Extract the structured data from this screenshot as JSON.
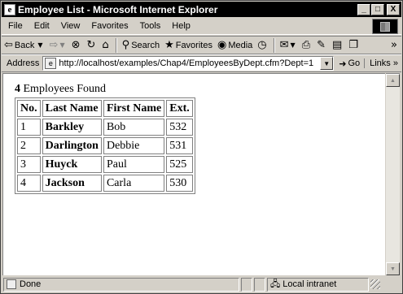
{
  "window": {
    "title": "Employee List - Microsoft Internet Explorer",
    "controls": {
      "minimize": "_",
      "maximize": "□",
      "close": "X"
    }
  },
  "menu": [
    "File",
    "Edit",
    "View",
    "Favorites",
    "Tools",
    "Help"
  ],
  "toolbar": {
    "back": "Back",
    "search": "Search",
    "favorites": "Favorites",
    "media": "Media"
  },
  "address": {
    "label": "Address",
    "value": "http://localhost/examples/Chap4/EmployeesByDept.cfm?Dept=1",
    "go": "Go",
    "links": "Links"
  },
  "page": {
    "count": "4",
    "found_text": " Employees Found",
    "table": {
      "headers": [
        "No.",
        "Last Name",
        "First Name",
        "Ext."
      ],
      "rows": [
        [
          "1",
          "Barkley",
          "Bob",
          "532"
        ],
        [
          "2",
          "Darlington",
          "Debbie",
          "531"
        ],
        [
          "3",
          "Huyck",
          "Paul",
          "525"
        ],
        [
          "4",
          "Jackson",
          "Carla",
          "530"
        ]
      ]
    }
  },
  "status": {
    "text": "Done",
    "zone": "Local intranet"
  }
}
